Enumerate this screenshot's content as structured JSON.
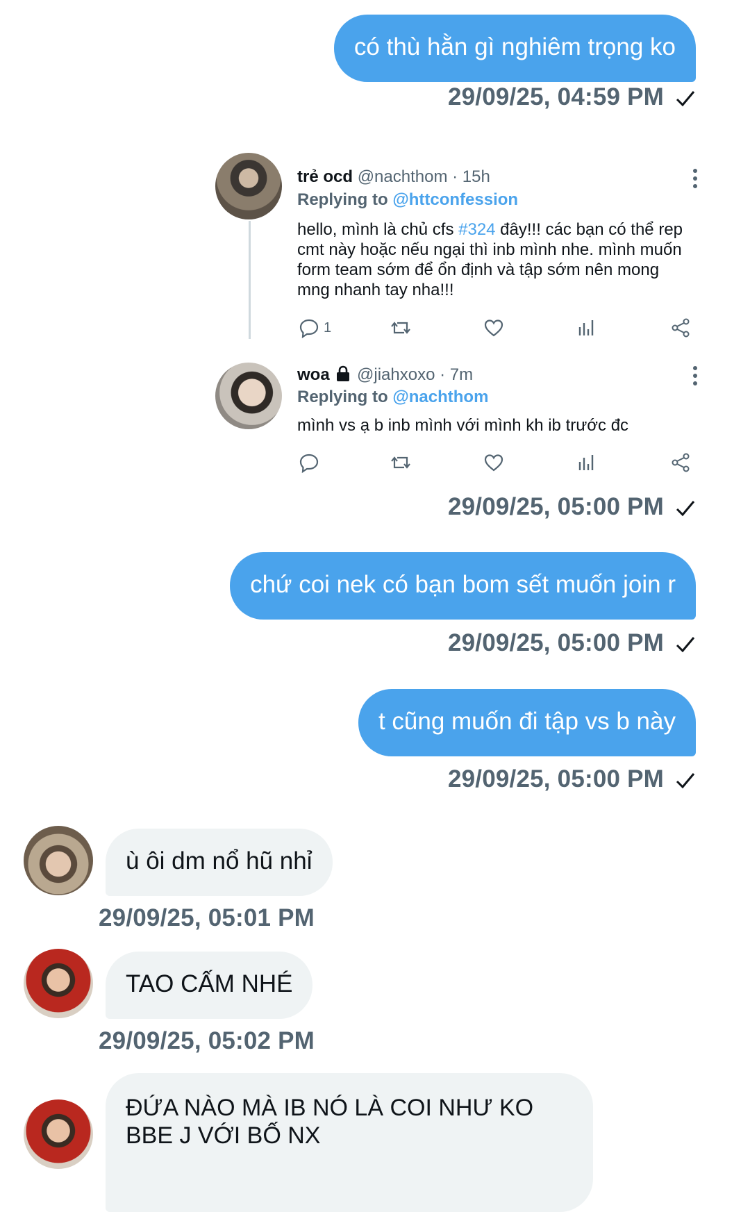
{
  "messages_out": [
    {
      "text": "có thù hằn gì nghiêm trọng ko",
      "time": "29/09/25, 04:59 PM"
    },
    {
      "text": "chứ coi nek có bạn bom sết muốn join r",
      "time": "29/09/25, 05:00 PM"
    },
    {
      "text": "t cũng muốn đi tập vs b này",
      "time": "29/09/25, 05:00 PM"
    }
  ],
  "shared_tweet": {
    "time": "29/09/25, 05:00 PM",
    "post": {
      "name": "trẻ ocd",
      "handle": "@nachthom",
      "age": "· 15h",
      "replying_label": "Replying to",
      "replying_to": "@httconfession",
      "body_before": "hello, mình là chủ cfs ",
      "hashtag": "#324",
      "body_after": " đây!!! các bạn có thể rep cmt này hoặc nếu ngại thì inb mình nhe. mình muốn form team sớm để ổn định và tập sớm nên mong mng nhanh tay nha!!!",
      "reply_count": "1"
    },
    "reply": {
      "name": "woa",
      "handle": "@jiahxoxo",
      "age": "· 7m",
      "replying_label": "Replying to",
      "replying_to": "@nachthom",
      "body": "mình vs ạ b inb mình với mình kh ib trước đc"
    }
  },
  "messages_in": [
    {
      "text": "ù ôi dm nổ hũ nhỉ",
      "time": "29/09/25, 05:01 PM"
    },
    {
      "text": "TAO CẤM NHÉ",
      "time": "29/09/25, 05:02 PM"
    },
    {
      "text": "ĐỨA NÀO MÀ IB NÓ LÀ COI NHƯ KO BBE J VỚI BỐ NX"
    }
  ],
  "colors": {
    "bubble_out": "#4aa3ec",
    "bubble_in": "#eff3f4",
    "timestamp": "#536471",
    "link": "#4aa3ec"
  },
  "icons": {
    "read": "checkmark-icon",
    "more": "more-vertical-icon",
    "reply": "reply-icon",
    "retweet": "retweet-icon",
    "like": "heart-icon",
    "views": "analytics-icon",
    "share": "share-icon",
    "locked": "lock-icon"
  }
}
